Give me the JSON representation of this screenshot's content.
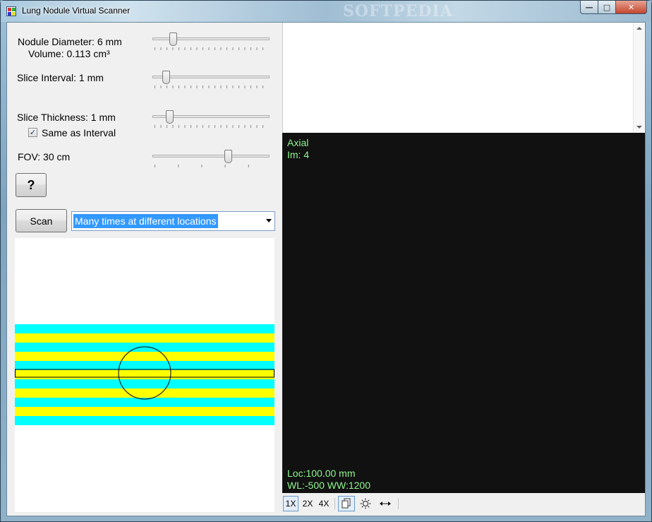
{
  "window": {
    "title": "Lung Nodule Virtual Scanner",
    "watermark": "SOFTPEDIA",
    "controls": {
      "minimize": "—",
      "maximize": "□",
      "close": "✕"
    }
  },
  "settings": {
    "nodule_diameter_label": "Nodule Diameter: 6 mm",
    "volume_label": "Volume: 0.113 cm³",
    "slice_interval_label": "Slice Interval: 1 mm",
    "slice_thickness_label": "Slice Thickness: 1 mm",
    "same_as_interval_label": "Same as Interval",
    "same_as_interval_checked": true,
    "fov_label": "FOV: 30 cm",
    "sliders": {
      "nodule_diameter": {
        "fraction": 0.16
      },
      "slice_interval": {
        "fraction": 0.1
      },
      "slice_thickness": {
        "fraction": 0.13
      },
      "fov": {
        "fraction": 0.65
      }
    }
  },
  "buttons": {
    "help_label": "?",
    "scan_label": "Scan"
  },
  "scan_mode": {
    "selected": "Many times at different locations"
  },
  "diagram": {
    "colors": {
      "band_a": "#00ffff",
      "band_b": "#ffff00",
      "outline": "#000000",
      "background": "#ffffff"
    },
    "band_count": 11
  },
  "viewer": {
    "orientation": "Axial",
    "image_label": "Im: 4",
    "location": "Loc:100.00 mm",
    "window": "WL:-500 WW:1200",
    "text_color": "#8ef58e",
    "background": "#111111"
  },
  "toolbar": {
    "zoom_1x": "1X",
    "zoom_2x": "2X",
    "zoom_4x": "4X",
    "selected_zoom": "1X",
    "icons": [
      "copy-icon",
      "brightness-icon",
      "horizontal-arrows-icon"
    ]
  }
}
